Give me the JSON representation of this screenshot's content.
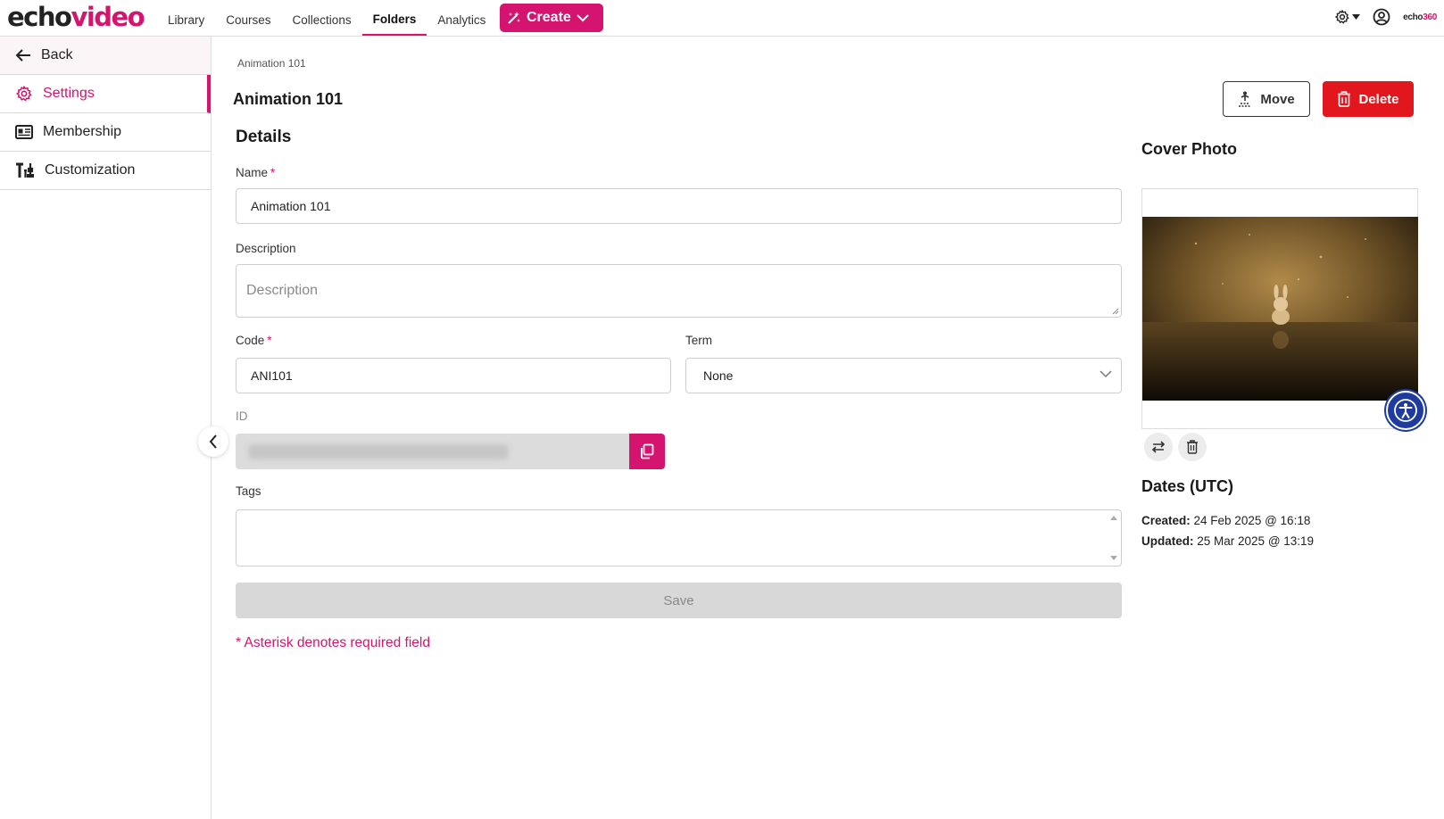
{
  "brand": {
    "logo_part1": "echo",
    "logo_part2": "video",
    "corner_part1": "echo",
    "corner_part2": "360"
  },
  "nav": {
    "items": [
      {
        "label": "Library"
      },
      {
        "label": "Courses"
      },
      {
        "label": "Collections"
      },
      {
        "label": "Folders",
        "active": true
      },
      {
        "label": "Analytics"
      }
    ],
    "create_label": "Create"
  },
  "sidebar": {
    "back_label": "Back",
    "items": [
      {
        "label": "Settings",
        "icon": "gear-icon",
        "active": true
      },
      {
        "label": "Membership",
        "icon": "id-card-icon"
      },
      {
        "label": "Customization",
        "icon": "customize-icon"
      }
    ]
  },
  "breadcrumb": "Animation 101",
  "page_title": "Animation 101",
  "actions": {
    "move_label": "Move",
    "delete_label": "Delete"
  },
  "details": {
    "heading": "Details",
    "name_label": "Name",
    "name_value": "Animation 101",
    "description_label": "Description",
    "description_placeholder": "Description",
    "code_label": "Code",
    "code_value": "ANI101",
    "term_label": "Term",
    "term_value": "None",
    "id_label": "ID",
    "tags_label": "Tags",
    "save_label": "Save",
    "required_note": "* Asterisk denotes required field",
    "asterisk": "*"
  },
  "cover": {
    "heading": "Cover Photo"
  },
  "dates": {
    "heading": "Dates (UTC)",
    "created_label": "Created:",
    "created_value": "24 Feb 2025 @ 16:18",
    "updated_label": "Updated:",
    "updated_value": "25 Mar 2025 @ 13:19"
  },
  "colors": {
    "accent": "#d4146e",
    "danger": "#e2161d",
    "a11y": "#1f3b9e"
  }
}
